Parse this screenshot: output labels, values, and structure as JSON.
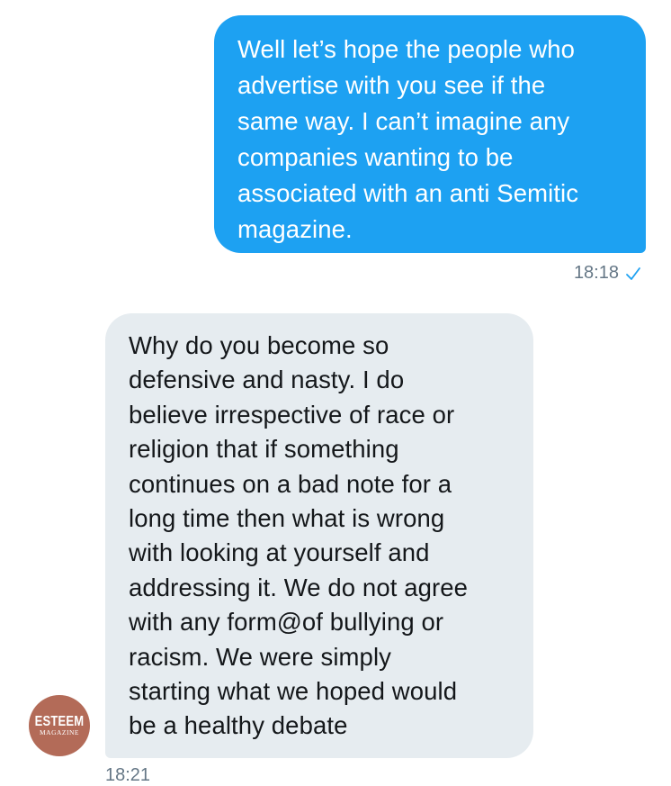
{
  "messages": {
    "outgoing": {
      "text": "Well let’s hope the people who\nadvertise with you see if the\nsame way. I can’t imagine any\ncompanies wanting to be\nassociated with an anti Semitic\nmagazine.",
      "time": "18:18",
      "status_icon": "check-icon",
      "bubble_color": "#1da1f2"
    },
    "incoming": {
      "text": "Why do you become so\ndefensive and nasty. I do\nbelieve irrespective of race or\nreligion that if something\ncontinues on a bad note for a\nlong time then what is wrong\nwith looking at yourself and\naddressing it. We do not agree\nwith any form@of bullying or\nracism. We were simply\nstarting what we hoped would\nbe a healthy debate",
      "time": "18:21",
      "bubble_color": "#e6ecf0"
    }
  },
  "sender": {
    "avatar_line1": "ESTEEM",
    "avatar_line2": "MAGAZINE",
    "avatar_color": "#b36b58"
  },
  "colors": {
    "meta_text": "#657786",
    "check": "#1da1f2"
  }
}
